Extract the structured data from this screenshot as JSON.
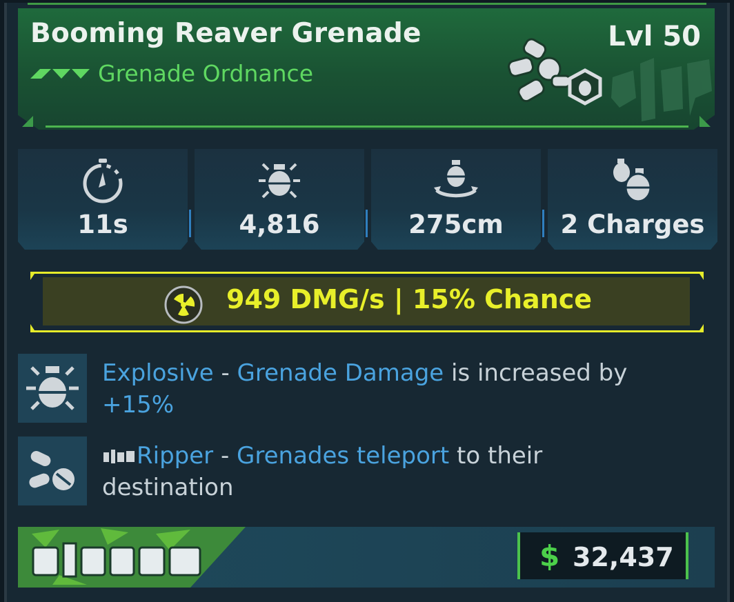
{
  "item": {
    "name": "Booming Reaver Grenade",
    "type": "Grenade Ordnance",
    "level": "Lvl 50",
    "rarity_color": "#5fd861",
    "manufacturer_logo_text": "RIPPER"
  },
  "stats": [
    {
      "icon": "timer-icon",
      "value": "11s"
    },
    {
      "icon": "grenade-damage-icon",
      "value": "4,816"
    },
    {
      "icon": "grenade-radius-icon",
      "value": "275cm"
    },
    {
      "icon": "grenade-charges-icon",
      "value": "2 Charges"
    }
  ],
  "element": {
    "icon": "radiation-icon",
    "text": "949 DMG/s | 15% Chance",
    "color": "#e8ef2a"
  },
  "perks": [
    {
      "icon": "explosive-perk-icon",
      "name": "Explosive",
      "dash": " - ",
      "keyword": "Grenade Damage",
      "rest": " is increased by",
      "value": "+15%"
    },
    {
      "icon": "ripper-perk-icon",
      "name": "Ripper",
      "dash": " - ",
      "keyword": "Grenades teleport",
      "rest": " to their",
      "line2": "destination"
    }
  ],
  "price": {
    "currency_symbol": "$",
    "value": "32,437"
  }
}
